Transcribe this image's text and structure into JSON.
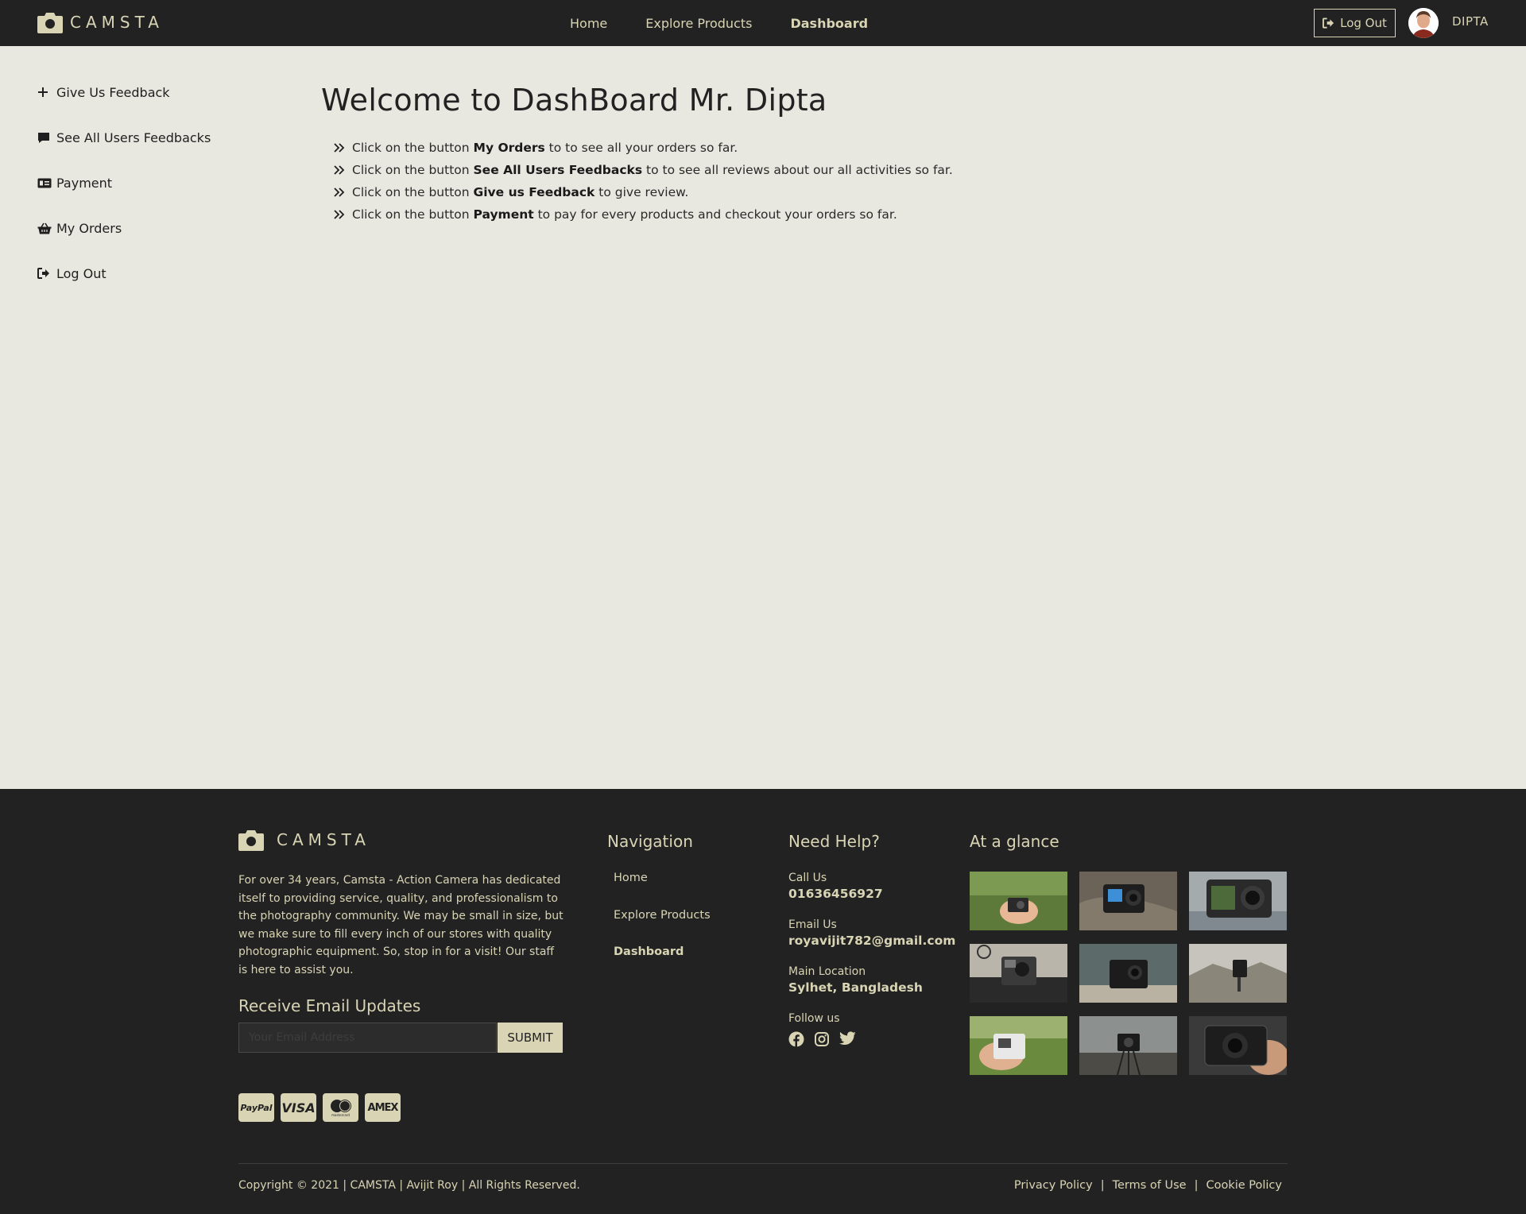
{
  "brand": {
    "name": "CAMSTA",
    "icon": "camera-icon"
  },
  "topnav": {
    "items": [
      {
        "label": "Home"
      },
      {
        "label": "Explore Products"
      },
      {
        "label": "Dashboard"
      }
    ],
    "logout_label": "Log Out",
    "username": "DIPTA"
  },
  "sidebar": {
    "items": [
      {
        "label": "Give Us Feedback",
        "icon": "plus-icon"
      },
      {
        "label": "See All Users Feedbacks",
        "icon": "comment-icon"
      },
      {
        "label": "Payment",
        "icon": "money-card-icon"
      },
      {
        "label": "My Orders",
        "icon": "basket-icon"
      },
      {
        "label": "Log Out",
        "icon": "logout-icon"
      }
    ]
  },
  "main": {
    "title": "Welcome to DashBoard Mr. Dipta",
    "tips": [
      {
        "pre": "Click on the button ",
        "bold": "My Orders",
        "post": " to to see all your orders so far."
      },
      {
        "pre": "Click on the button ",
        "bold": "See All Users Feedbacks",
        "post": " to to see all reviews about our all activities so far."
      },
      {
        "pre": "Click on the button ",
        "bold": "Give us Feedback",
        "post": " to give review."
      },
      {
        "pre": "Click on the button ",
        "bold": "Payment",
        "post": " to pay for every products and checkout your orders so far."
      }
    ]
  },
  "footer": {
    "brand": "CAMSTA",
    "about": "For over 34 years, Camsta - Action Camera has dedicated itself to providing service, quality, and professionalism to the photography community. We may be small in size, but we make sure to fill every inch of our stores with quality photographic equipment. So, stop in for a visit! Our staff is here to assist you.",
    "subscribe_heading": "Receive Email Updates",
    "email_placeholder": "Your Email Address",
    "submit_label": "SUBMIT",
    "payment_cards": [
      "PayPal",
      "VISA",
      "mastercard",
      "AMEX"
    ],
    "navigation_heading": "Navigation",
    "navigation": [
      "Home",
      "Explore Products",
      "Dashboard"
    ],
    "help_heading": "Need Help?",
    "call_label": "Call Us",
    "call_value": "01636456927",
    "email_label": "Email Us",
    "email_value": "royavijit782@gmail.com",
    "location_label": "Main Location",
    "location_value": "Sylhet, Bangladesh",
    "follow_label": "Follow us",
    "social": [
      "facebook-icon",
      "instagram-icon",
      "twitter-icon"
    ],
    "glance_heading": "At a glance",
    "copyright": "Copyright © 2021 | CAMSTA | Avijit Roy | All Rights Reserved.",
    "legal": [
      "Privacy Policy",
      "Terms of Use",
      "Cookie Policy"
    ]
  },
  "colors": {
    "bar": "#222222",
    "accent": "#d8d4b4",
    "page_bg": "#e8e7e0"
  }
}
